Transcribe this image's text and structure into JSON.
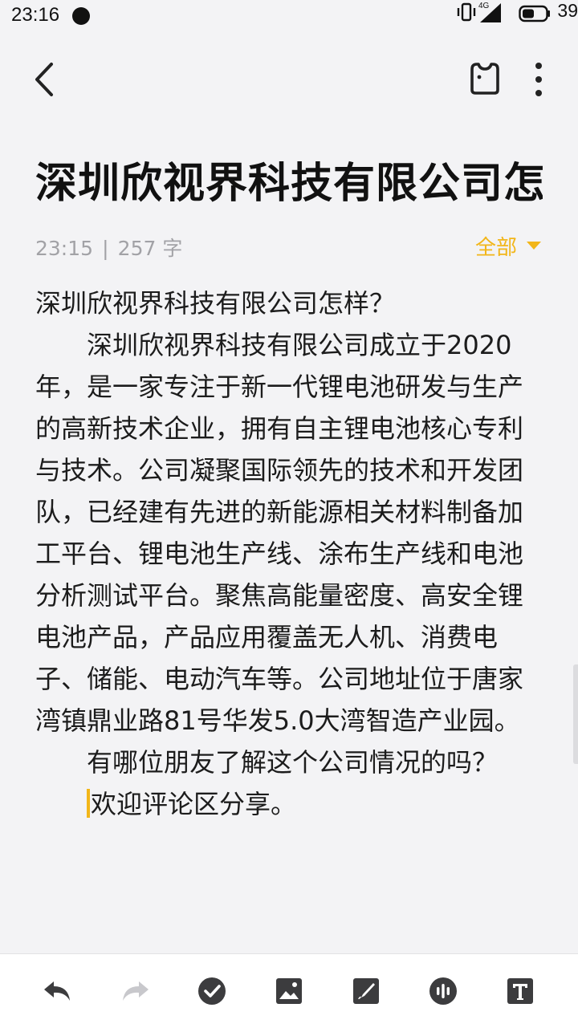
{
  "status_bar": {
    "time": "23:16",
    "network": "4G",
    "battery": "39"
  },
  "note": {
    "title": "深圳欣视界科技有限公司怎样？",
    "time": "23:15",
    "separator": "|",
    "count": "257 字",
    "filter": "全部",
    "paragraphs": [
      "深圳欣视界科技有限公司怎样？",
      "深圳欣视界科技有限公司成立于2020年，是一家专注于新一代锂电池研发与生产的高新技术企业，拥有自主锂电池核心专利与技术。公司凝聚国际领先的技术和开发团队，已经建有先进的新能源相关材料制备加工平台、锂电池生产线、涂布生产线和电池分析测试平台。聚焦高能量密度、高安全锂电池产品，产品应用覆盖无人机、消费电子、储能、电动汽车等。公司地址位于唐家湾镇鼎业路81号华发5.0大湾智造产业园。",
      "有哪位朋友了解这个公司情况的吗？",
      "欢迎评论区分享。"
    ]
  },
  "colors": {
    "accent": "#f2b619",
    "background": "#f3f3f5",
    "meta_text": "#a2a2a6",
    "icon_dark": "#3c3c3e",
    "icon_disabled": "#c8c8cc"
  },
  "bottom_toolbar": {
    "icons": [
      "undo-icon",
      "redo-icon",
      "checklist-icon",
      "image-icon",
      "brush-icon",
      "voice-icon",
      "text-format-icon"
    ]
  }
}
